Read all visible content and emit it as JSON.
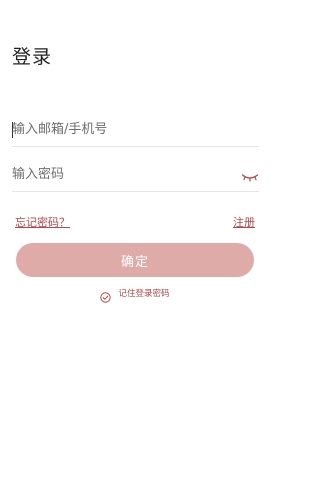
{
  "header": {
    "title": "登录"
  },
  "form": {
    "account": {
      "value": "",
      "placeholder": "输入邮箱/手机号"
    },
    "password": {
      "value": "",
      "placeholder": "输入密码",
      "toggle_icon": "eye-closed-icon"
    },
    "forgot_password_label": "忘记密码？",
    "register_label": "注册",
    "confirm_label": "确定",
    "remember": {
      "label": "记住登录密码",
      "checked": true,
      "icon": "check-circle-icon"
    }
  },
  "colors": {
    "accent": "#b3474a",
    "button": "#deaba9",
    "divider": "#e6e6e6"
  }
}
